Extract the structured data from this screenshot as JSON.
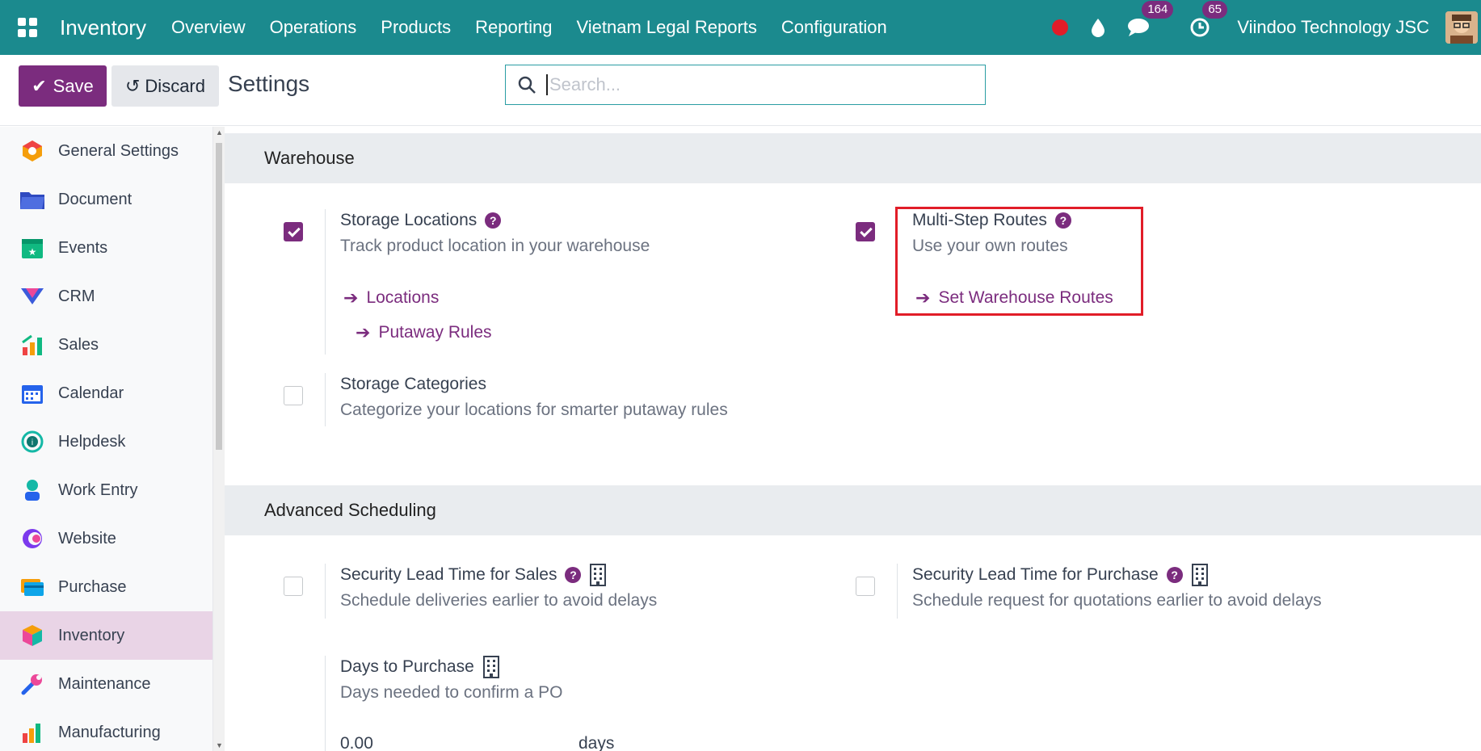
{
  "navbar": {
    "app_name": "Inventory",
    "menu": [
      "Overview",
      "Operations",
      "Products",
      "Reporting",
      "Vietnam Legal Reports",
      "Configuration"
    ],
    "messages_count": "164",
    "activities_count": "65",
    "company": "Viindoo Technology JSC"
  },
  "control": {
    "save_label": "Save",
    "discard_label": "Discard",
    "title": "Settings",
    "search_placeholder": "Search..."
  },
  "sidebar": {
    "items": [
      {
        "label": "General Settings",
        "icon": "general-settings-icon"
      },
      {
        "label": "Document",
        "icon": "folder-icon"
      },
      {
        "label": "Events",
        "icon": "events-icon"
      },
      {
        "label": "CRM",
        "icon": "crm-icon"
      },
      {
        "label": "Sales",
        "icon": "sales-icon"
      },
      {
        "label": "Calendar",
        "icon": "calendar-icon"
      },
      {
        "label": "Helpdesk",
        "icon": "helpdesk-icon"
      },
      {
        "label": "Work Entry",
        "icon": "work-entry-icon"
      },
      {
        "label": "Website",
        "icon": "website-icon"
      },
      {
        "label": "Purchase",
        "icon": "purchase-icon"
      },
      {
        "label": "Inventory",
        "icon": "inventory-icon",
        "active": true
      },
      {
        "label": "Maintenance",
        "icon": "wrench-icon"
      },
      {
        "label": "Manufacturing",
        "icon": "manufacturing-icon"
      }
    ]
  },
  "warehouse": {
    "heading": "Warehouse",
    "storage_locations": {
      "title": "Storage Locations",
      "desc": "Track product location in your warehouse",
      "checked": true,
      "link_locations": "Locations",
      "link_putaway": "Putaway Rules"
    },
    "multi_step": {
      "title": "Multi-Step Routes",
      "desc": "Use your own routes",
      "checked": true,
      "link": "Set Warehouse Routes"
    },
    "storage_categories": {
      "title": "Storage Categories",
      "desc": "Categorize your locations for smarter putaway rules",
      "checked": false
    }
  },
  "advanced": {
    "heading": "Advanced Scheduling",
    "sales_lead": {
      "title": "Security Lead Time for Sales",
      "desc": "Schedule deliveries earlier to avoid delays",
      "checked": false
    },
    "purchase_lead": {
      "title": "Security Lead Time for Purchase",
      "desc": "Schedule request for quotations earlier to avoid delays",
      "checked": false
    },
    "days_to_purchase": {
      "title": "Days to Purchase",
      "desc": "Days needed to confirm a PO",
      "value": "0.00",
      "unit": "days"
    }
  },
  "colors": {
    "navbar": "#1b8a8e",
    "primary": "#7b2c7e",
    "highlight": "#e11d28"
  }
}
